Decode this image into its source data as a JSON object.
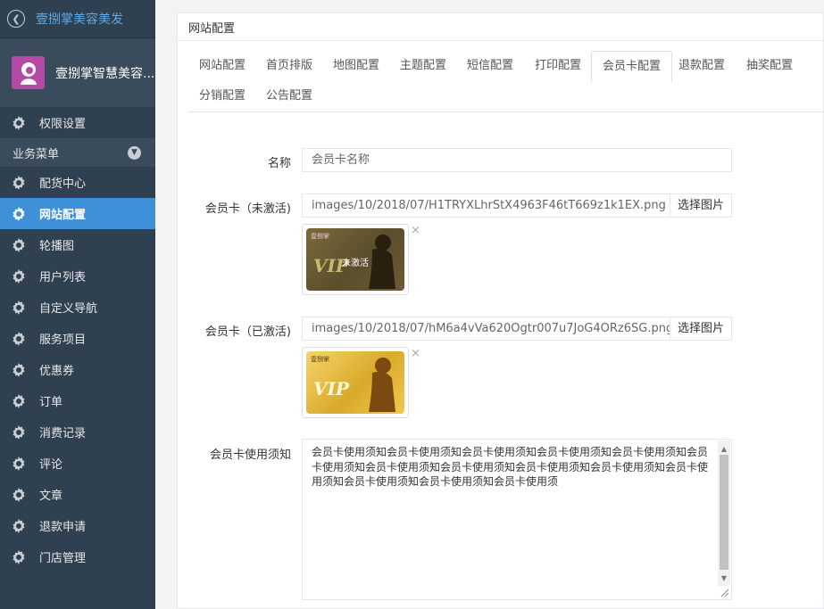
{
  "brand": {
    "title": "壹捌掌美容美发"
  },
  "profile": {
    "name": "壹捌掌智慧美容..."
  },
  "sidebar": {
    "top_item": "权限设置",
    "section_label": "业务菜单",
    "items": [
      {
        "label": "配货中心",
        "active": false
      },
      {
        "label": "网站配置",
        "active": true
      },
      {
        "label": "轮播图",
        "active": false
      },
      {
        "label": "用户列表",
        "active": false
      },
      {
        "label": "自定义导航",
        "active": false
      },
      {
        "label": "服务项目",
        "active": false
      },
      {
        "label": "优惠券",
        "active": false
      },
      {
        "label": "订单",
        "active": false
      },
      {
        "label": "消费记录",
        "active": false
      },
      {
        "label": "评论",
        "active": false
      },
      {
        "label": "文章",
        "active": false
      },
      {
        "label": "退款申请",
        "active": false
      },
      {
        "label": "门店管理",
        "active": false
      }
    ]
  },
  "panel": {
    "title": "网站配置"
  },
  "tabs": [
    {
      "label": "网站配置"
    },
    {
      "label": "首页排版"
    },
    {
      "label": "地图配置"
    },
    {
      "label": "主题配置"
    },
    {
      "label": "短信配置"
    },
    {
      "label": "打印配置"
    },
    {
      "label": "会员卡配置",
      "active": true
    },
    {
      "label": "退款配置"
    },
    {
      "label": "抽奖配置"
    },
    {
      "label": "分销配置"
    },
    {
      "label": "公告配置"
    }
  ],
  "form": {
    "name_label": "名称",
    "name_value": "会员卡名称",
    "inactive_label": "会员卡（未激活)",
    "inactive_path": "images/10/2018/07/H1TRYXLhrStX4963F46tT669z1k1EX.png",
    "active_label": "会员卡（已激活)",
    "active_path": "images/10/2018/07/hM6a4vVa620Ogtr007u7JoG4ORz6SG.png",
    "select_image_btn": "选择图片",
    "close_symbol": "×",
    "notice_label": "会员卡使用须知",
    "notice_text": "会员卡使用须知会员卡使用须知会员卡使用须知会员卡使用须知会员卡使用须知会员卡使用须知会员卡使用须知会员卡使用须知会员卡使用须知会员卡使用须知会员卡使用须知会员卡使用须知会员卡使用须知会员卡使用须"
  },
  "cards": {
    "inactive": {
      "brand": "壹捌掌",
      "vip": "VIP",
      "status": "未激活"
    },
    "active": {
      "brand": "壹捌掌",
      "vip": "VIP"
    }
  },
  "colors": {
    "sidebar_bg": "#2f4050",
    "active_item": "#3e90d8",
    "brand_text": "#5da8e6"
  }
}
